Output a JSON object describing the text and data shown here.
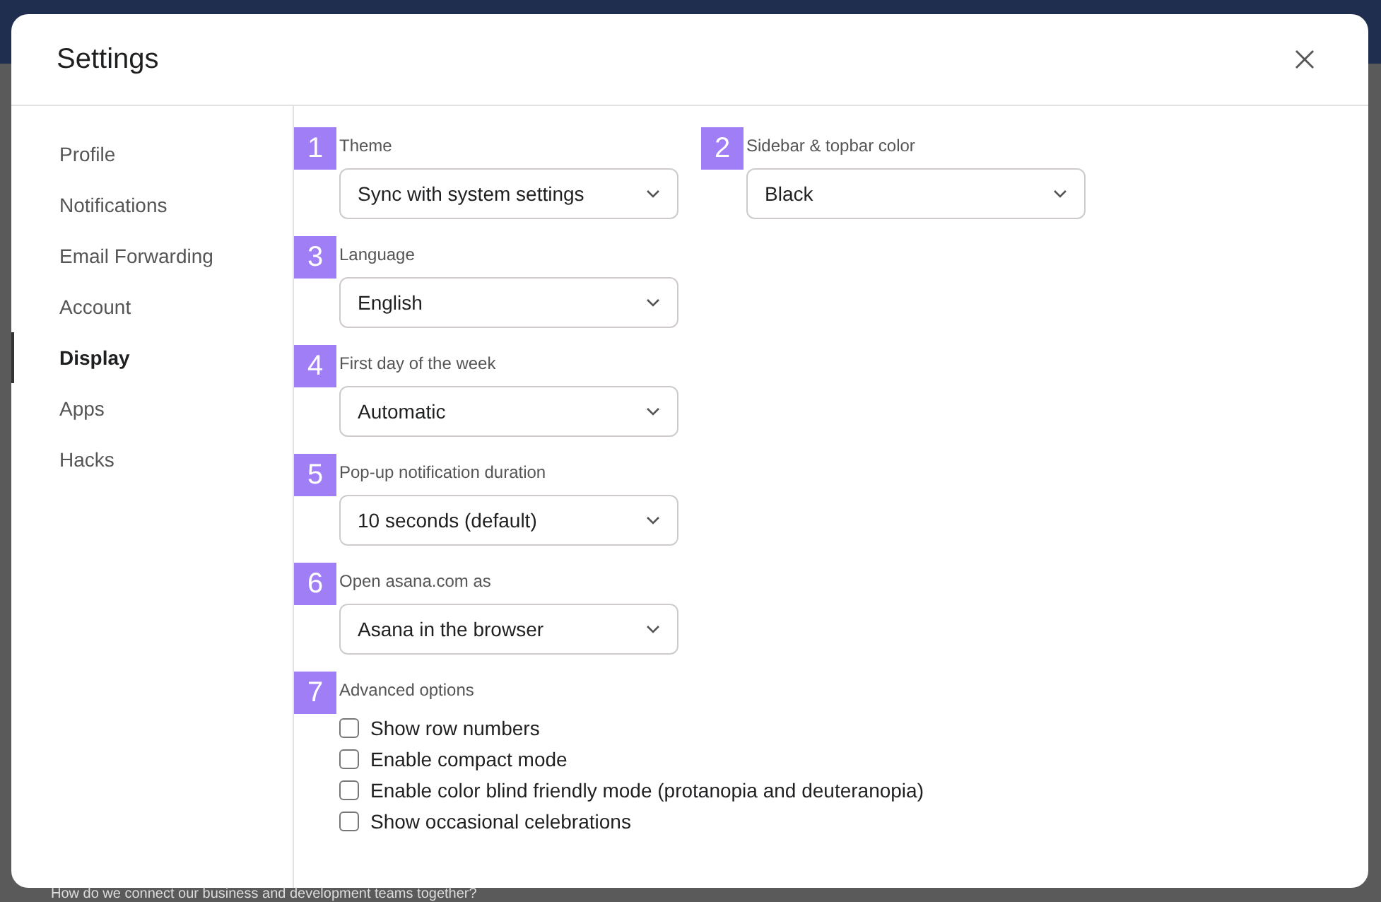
{
  "dialog": {
    "title": "Settings"
  },
  "sidebar": {
    "items": [
      {
        "label": "Profile",
        "selected": false
      },
      {
        "label": "Notifications",
        "selected": false
      },
      {
        "label": "Email Forwarding",
        "selected": false
      },
      {
        "label": "Account",
        "selected": false
      },
      {
        "label": "Display",
        "selected": true
      },
      {
        "label": "Apps",
        "selected": false
      },
      {
        "label": "Hacks",
        "selected": false
      }
    ]
  },
  "rows": [
    [
      {
        "badge": "1",
        "label": "Theme",
        "value": "Sync with system settings"
      },
      {
        "badge": "2",
        "label": "Sidebar & topbar color",
        "value": "Black"
      }
    ],
    [
      {
        "badge": "3",
        "label": "Language",
        "value": "English"
      }
    ],
    [
      {
        "badge": "4",
        "label": "First day of the week",
        "value": "Automatic"
      }
    ],
    [
      {
        "badge": "5",
        "label": "Pop-up notification duration",
        "value": "10 seconds (default)"
      }
    ],
    [
      {
        "badge": "6",
        "label": "Open asana.com as",
        "value": "Asana in the browser"
      }
    ]
  ],
  "advanced": {
    "badge": "7",
    "label": "Advanced options",
    "options": [
      {
        "label": "Show row numbers",
        "checked": false
      },
      {
        "label": "Enable compact mode",
        "checked": false
      },
      {
        "label": "Enable color blind friendly mode (protanopia and deuteranopia)",
        "checked": false
      },
      {
        "label": "Show occasional celebrations",
        "checked": false
      }
    ]
  },
  "background": {
    "text": "How do we connect our business and development teams together?"
  }
}
